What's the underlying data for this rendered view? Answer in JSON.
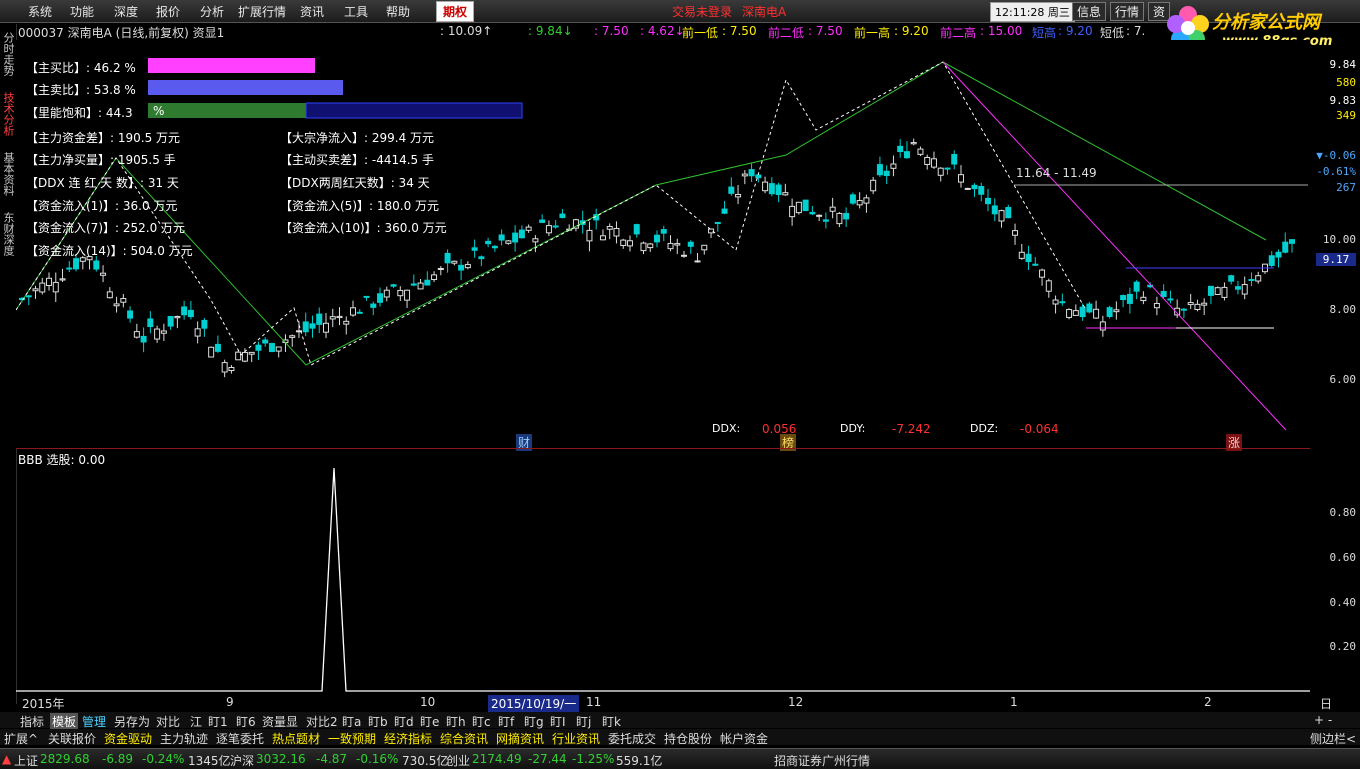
{
  "menu": {
    "items": [
      "系统",
      "功能",
      "深度",
      "报价",
      "分析",
      "扩展行情",
      "资讯",
      "工具",
      "帮助"
    ],
    "option_tab": "期权",
    "status_login": "交易未登录",
    "status_stock": "深南电A",
    "clock": "12:11:28 周三",
    "right_buttons": [
      "信息",
      "行情",
      "资"
    ]
  },
  "logo": {
    "name": "分析家公式网",
    "url": "www.88gs.com"
  },
  "left_nav": [
    "分时走势",
    "技术分析",
    "基本资料",
    "东财深度"
  ],
  "header": {
    "title": "000037 深南电A (日线,前复权) 资显1",
    "v1": ": 10.09↑",
    "v2": ": 9.84↓",
    "v3": ": 7.50",
    "v4": ": 4.62↓",
    "qianyidi_label": "前一低",
    "qianyidi": ": 7.50",
    "qianerdi_label": "前二低",
    "qianerdi": ": 7.50",
    "qianyigao_label": "前一高",
    "qianyigao": ": 9.20",
    "qianergao_label": "前二高",
    "qianergao": ": 15.00",
    "duangao_label": "短高",
    "duangao": ": 9.20",
    "duandi_label": "短低",
    "duandi": ": 7."
  },
  "indicators": {
    "buy_ratio": "【主买比】: 46.2 %",
    "sell_ratio": "【主卖比】: 53.8 %",
    "saturation": "【里能饱和】: 44.3",
    "saturation_pct": "%",
    "zhuli_zijincha": "【主力资金差】: 190.5 万元",
    "dazong": "【大宗净流入】: 299.4 万元",
    "zhuli_jingmai": "【主力净买量】: 1905.5 手",
    "zhudong_maimai": "【主动买卖差】: -4414.5 手",
    "ddx_lianhong": "【DDX 连 红 天 数】: 31 天",
    "ddx_two_week": "【DDX两周红天数】: 34 天",
    "liuru1": "【资金流入(1)】: 36.0 万元",
    "liuru5": "【资金流入(5)】: 180.0 万元",
    "liuru7": "【资金流入(7)】: 252.0 万元",
    "liuru10": "【资金流入(10)】: 360.0 万元",
    "liuru14": "【资金流入(14)】: 504.0 万元"
  },
  "range_label": "11.64 - 11.49",
  "dd": {
    "ddx_label": "DDX:",
    "ddx": "0.056",
    "ddy_label": "DDY:",
    "ddy": "-7.242",
    "ddz_label": "DDZ:",
    "ddz": "-0.064"
  },
  "markers": {
    "cai": "财",
    "bang": "榜",
    "zhang": "涨"
  },
  "sub": {
    "title": "BBB 选股: 0.00"
  },
  "axis_right_main": [
    "9.84",
    "9.83",
    "580",
    "349",
    "▼-0.06",
    "-0.61%",
    "267",
    "10.00",
    "9.17",
    "8.00",
    "6.00"
  ],
  "axis_right_sub": [
    "0.80",
    "0.60",
    "0.40",
    "0.20"
  ],
  "x_axis": {
    "labels": [
      "2015年",
      "9",
      "10",
      "2015/10/19/一",
      "11",
      "12",
      "1",
      "2"
    ],
    "period": "日线"
  },
  "tabs_row1": [
    "指标",
    "模板",
    "管理",
    "另存为",
    "对比",
    "江",
    "盯1",
    "盯6",
    "资量显",
    "对比2",
    "盯a",
    "盯b",
    "盯d",
    "盯e",
    "盯h",
    "盯c",
    "盯f",
    "盯g",
    "盯I",
    "盯j",
    "盯k"
  ],
  "tabs_row1_right": "+  -",
  "tabs_row2": [
    "扩展^",
    "关联报价",
    "资金驱动",
    "主力轨迹",
    "逐笔委托",
    "热点题材",
    "一致预期",
    "经济指标",
    "综合资讯",
    "网摘资讯",
    "行业资讯",
    "委托成交",
    "持仓股份",
    "帐户资金"
  ],
  "tabs_row2_right": "侧边栏<",
  "statusbar": {
    "sh_label": "上证",
    "sh_val": "2829.68",
    "sh_chg": "-6.89",
    "sh_pct": "-0.24%",
    "sh_amt": "1345亿",
    "sz_label": "沪深",
    "sz_val": "3032.16",
    "sz_chg": "-4.87",
    "sz_pct": "-0.16%",
    "sz_amt": "730.5亿",
    "cy_label": "创业",
    "cy_val": "2174.49",
    "cy_chg": "-27.44",
    "cy_pct": "-1.25%",
    "cy_amt": "559.1亿",
    "broker": "招商证券广州行情"
  },
  "colors": {
    "up": "#ff4040",
    "down": "#00d0d0",
    "ma": "#30c030",
    "pink": "#ff30ff",
    "blue": "#4040ff",
    "gray": "#aaaaaa"
  }
}
